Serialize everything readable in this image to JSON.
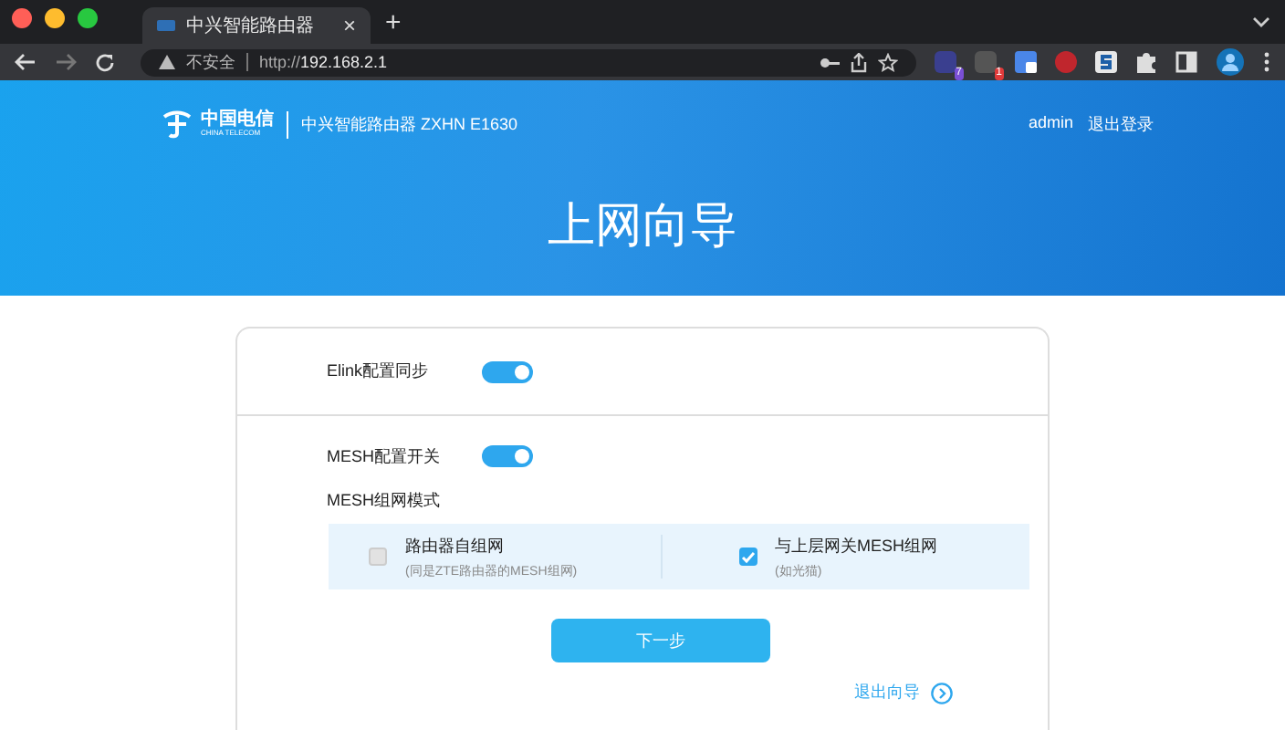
{
  "browser": {
    "tab_title": "中兴智能路由器",
    "new_tab": "+",
    "close": "×",
    "security_label": "不安全",
    "url_prefix": "http://",
    "url_host": "192.168.2.1",
    "extension_badges": [
      {
        "text": "7",
        "color": "#7a4fd6"
      },
      {
        "text": "1",
        "color": "#e03a3a"
      }
    ]
  },
  "header": {
    "logo_cn": "中国电信",
    "logo_en": "CHINA TELECOM",
    "product": "中兴智能路由器 ZXHN E1630",
    "user": "admin",
    "logout": "退出登录",
    "title": "上网向导"
  },
  "settings": [
    {
      "label": "Elink配置同步",
      "on": true
    },
    {
      "label": "MESH配置开关",
      "on": true
    }
  ],
  "mesh_mode": {
    "label": "MESH组网模式",
    "options": [
      {
        "title": "路由器自组网",
        "note": "(同是ZTE路由器的MESH组网)",
        "selected": false
      },
      {
        "title": "与上层网关MESH组网",
        "note": "(如光猫)",
        "selected": true
      }
    ]
  },
  "next_button": "下一步",
  "exit_link": "退出向导"
}
